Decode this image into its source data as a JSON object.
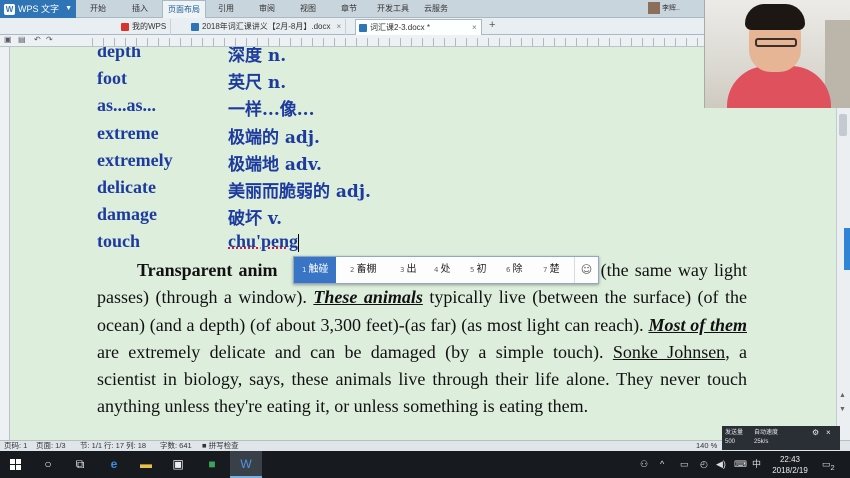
{
  "titlebar": {
    "app_name": "WPS 文字",
    "menus": [
      "开始",
      "插入",
      "页面布局",
      "引用",
      "审阅",
      "视图",
      "章节",
      "开发工具",
      "云服务"
    ],
    "active_menu": "页面布局",
    "user_name": "李辉.."
  },
  "tabs": [
    {
      "label": "我的WPS",
      "icon_color": "#d9342b"
    },
    {
      "label": "2018年词汇课讲义【2月-8月】.docx",
      "icon_color": "#2f74b5"
    },
    {
      "label": "词汇课2-3.docx *",
      "icon_color": "#2f74b5"
    }
  ],
  "vocab": [
    {
      "en": "depth",
      "zh": "深度 n."
    },
    {
      "en": "foot",
      "zh": "英尺 n."
    },
    {
      "en": "as...as...",
      "zh": "一样...像..."
    },
    {
      "en": "extreme",
      "zh": "极端的 adj."
    },
    {
      "en": "extremely",
      "zh": "极端地 adv."
    },
    {
      "en": "delicate",
      "zh": "美丽而脆弱的 adj."
    },
    {
      "en": "damage",
      "zh": "破坏 v."
    },
    {
      "en": "touch",
      "zh": "chu'peng"
    }
  ],
  "paragraph": {
    "lead": "Transparent anim",
    "t1": "es) (the same way light passes) (through a window). ",
    "e1": "These animals",
    "t2": " typically live (between the surface) (of the ocean) (and a depth) (of about 3,300 feet)-(as far) (as most light can reach). ",
    "e2": "Most of them",
    "t3": " are extremely delicate and can be damaged (by a simple touch). ",
    "u1": "Sonke Johnsen",
    "t4": ", a scientist in biology, says, these animals live through their life alone. They never touch anything unless they're eating it, or unless something is eating them."
  },
  "ime": {
    "candidates": [
      {
        "num": "1",
        "text": "触碰"
      },
      {
        "num": "2",
        "text": "畜棚"
      },
      {
        "num": "3",
        "text": "出"
      },
      {
        "num": "4",
        "text": "处"
      },
      {
        "num": "5",
        "text": "初"
      },
      {
        "num": "6",
        "text": "除"
      },
      {
        "num": "7",
        "text": "楚"
      }
    ],
    "emoji_icon": "☺"
  },
  "status": {
    "page_no": "页码: 1",
    "pages": "页面: 1/3",
    "section": "节: 1/1",
    "row_col": "行: 17  列: 18",
    "words": "字数: 641",
    "spell": "拼写检查",
    "zoom": "140 %"
  },
  "speed": {
    "upload": "500",
    "download": "25k/s",
    "upload_label": "发送量",
    "download_label": "自动速度"
  },
  "taskbar": {
    "time": "22:43",
    "date": "2018/2/19",
    "ime_lang": "中",
    "notifications": "2"
  }
}
